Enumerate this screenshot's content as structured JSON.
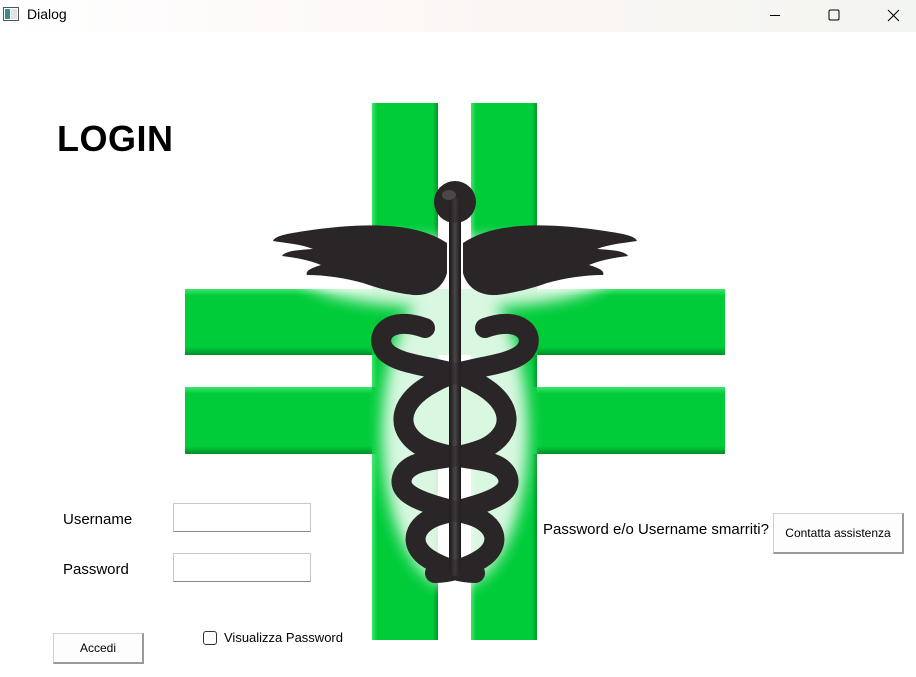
{
  "window": {
    "title": "Dialog",
    "controls": {
      "minimize": "minimize-icon",
      "maximize": "maximize-icon",
      "close": "close-icon"
    }
  },
  "form": {
    "heading": "LOGIN",
    "username_label": "Username",
    "username_value": "",
    "password_label": "Password",
    "password_value": "",
    "login_button": "Accedi",
    "show_password_label": "Visualizza Password",
    "show_password_checked": false
  },
  "support": {
    "question": "Password e/o Username smarriti?",
    "contact_button": "Contatta assistenza"
  },
  "logo": {
    "icon": "pharmacy-cross-caduceus-logo",
    "cross_color": "#00cc3a",
    "caduceus_color": "#2a2627"
  }
}
